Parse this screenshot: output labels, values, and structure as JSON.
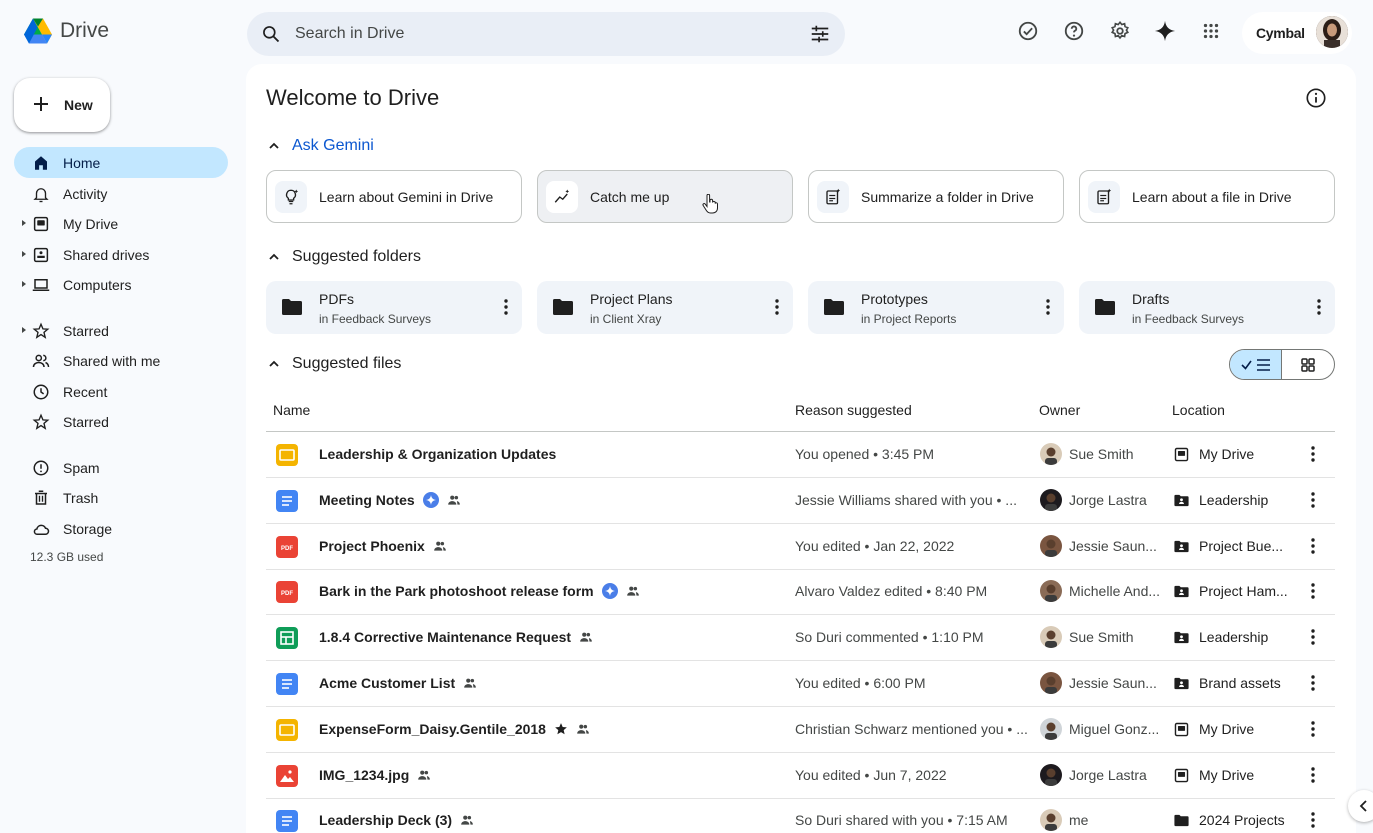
{
  "app": {
    "name": "Drive"
  },
  "search": {
    "placeholder": "Search in Drive"
  },
  "account": {
    "brand": "Cymbal"
  },
  "sidebar": {
    "new_label": "New",
    "items": [
      {
        "label": "Home",
        "icon": "home-icon",
        "active": true
      },
      {
        "label": "Activity",
        "icon": "bell-icon"
      },
      {
        "label": "My Drive",
        "icon": "my-drive-icon",
        "expandable": true
      },
      {
        "label": "Shared drives",
        "icon": "shared-drives-icon",
        "expandable": true
      },
      {
        "label": "Computers",
        "icon": "computer-icon",
        "expandable": true
      },
      {
        "label": "Starred",
        "icon": "star-icon",
        "expandable": true
      },
      {
        "label": "Shared with me",
        "icon": "people-icon"
      },
      {
        "label": "Recent",
        "icon": "clock-icon"
      },
      {
        "label": "Starred",
        "icon": "star-icon"
      },
      {
        "label": "Spam",
        "icon": "spam-icon"
      },
      {
        "label": "Trash",
        "icon": "trash-icon"
      },
      {
        "label": "Storage",
        "icon": "cloud-icon"
      }
    ],
    "storage_used": "12.3 GB used"
  },
  "main": {
    "title": "Welcome to Drive",
    "gemini": {
      "label": "Ask Gemini",
      "chips": [
        {
          "label": "Learn about Gemini in Drive",
          "icon": "lightbulb-sparkle-icon"
        },
        {
          "label": "Catch me up",
          "icon": "trend-sparkle-icon"
        },
        {
          "label": "Summarize a folder in Drive",
          "icon": "doc-sparkle-icon"
        },
        {
          "label": "Learn about a file in Drive",
          "icon": "doc-sparkle-icon"
        }
      ]
    },
    "folders": {
      "label": "Suggested folders",
      "items": [
        {
          "name": "PDFs",
          "location": "in Feedback Surveys"
        },
        {
          "name": "Project Plans",
          "location": "in Client Xray"
        },
        {
          "name": "Prototypes",
          "location": "in Project Reports"
        },
        {
          "name": "Drafts",
          "location": "in Feedback Surveys"
        }
      ]
    },
    "files": {
      "label": "Suggested files",
      "columns": {
        "name": "Name",
        "reason": "Reason suggested",
        "owner": "Owner",
        "location": "Location"
      },
      "rows": [
        {
          "name": "Leadership & Organization Updates",
          "type": "slides",
          "gemini": false,
          "shared": false,
          "starred": false,
          "reason": "You opened • 3:45 PM",
          "owner": "Sue Smith",
          "location": "My Drive",
          "loc_type": "my-drive"
        },
        {
          "name": "Meeting Notes",
          "type": "docs",
          "gemini": true,
          "shared": true,
          "starred": false,
          "reason": "Jessie Williams shared with you • ...",
          "owner": "Jorge Lastra",
          "location": "Leadership",
          "loc_type": "shared-folder"
        },
        {
          "name": "Project Phoenix",
          "type": "pdf",
          "gemini": false,
          "shared": true,
          "starred": false,
          "reason": "You edited • Jan 22, 2022",
          "owner": "Jessie Saun...",
          "location": "Project Bue...",
          "loc_type": "shared-folder"
        },
        {
          "name": "Bark in the Park photoshoot release form",
          "type": "pdf",
          "gemini": true,
          "shared": true,
          "starred": false,
          "reason": "Alvaro Valdez edited • 8:40 PM",
          "owner": "Michelle And...",
          "location": "Project Ham...",
          "loc_type": "shared-folder"
        },
        {
          "name": "1.8.4 Corrective Maintenance Request",
          "type": "sheets",
          "gemini": false,
          "shared": true,
          "starred": false,
          "reason": "So Duri commented • 1:10 PM",
          "owner": "Sue Smith",
          "location": "Leadership",
          "loc_type": "shared-folder"
        },
        {
          "name": "Acme Customer List",
          "type": "docs",
          "gemini": false,
          "shared": true,
          "starred": false,
          "reason": "You edited • 6:00 PM",
          "owner": "Jessie Saun...",
          "location": "Brand assets",
          "loc_type": "shared-folder"
        },
        {
          "name": "ExpenseForm_Daisy.Gentile_2018",
          "type": "slides",
          "gemini": false,
          "shared": true,
          "starred": true,
          "reason": "Christian Schwarz mentioned you • ...",
          "owner": "Miguel Gonz...",
          "location": "My Drive",
          "loc_type": "my-drive"
        },
        {
          "name": "IMG_1234.jpg",
          "type": "image",
          "gemini": false,
          "shared": true,
          "starred": false,
          "reason": "You edited • Jun 7, 2022",
          "owner": "Jorge Lastra",
          "location": "My Drive",
          "loc_type": "my-drive"
        },
        {
          "name": "Leadership Deck (3)",
          "type": "docs",
          "gemini": false,
          "shared": true,
          "starred": false,
          "reason": "So Duri shared with you • 7:15 AM",
          "owner": "me",
          "location": "2024 Projects",
          "loc_type": "folder"
        }
      ]
    }
  },
  "colors": {
    "accent": "#0b57d0",
    "active_nav": "#c2e7ff",
    "slides": "#f4b400",
    "docs": "#4285f4",
    "pdf": "#ea4335",
    "sheets": "#0f9d58",
    "image": "#ea4335"
  }
}
